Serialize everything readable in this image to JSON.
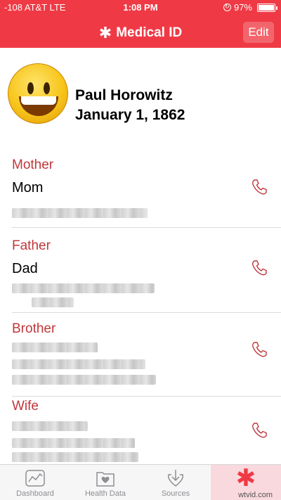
{
  "status": {
    "carrier": "-108 AT&T  LTE",
    "time": "1:08 PM",
    "battery": "97%",
    "battery_level": 0.97
  },
  "nav": {
    "star": "✱",
    "title": "Medical ID",
    "edit_label": "Edit"
  },
  "profile": {
    "name": "Paul Horowitz",
    "dob": "January 1, 1862"
  },
  "contacts": [
    {
      "relation": "Mother",
      "name": "Mom"
    },
    {
      "relation": "Father",
      "name": "Dad"
    },
    {
      "relation": "Brother",
      "name": ""
    },
    {
      "relation": "Wife",
      "name": ""
    }
  ],
  "tabs": [
    {
      "label": "Dashboard",
      "icon": "chart-icon"
    },
    {
      "label": "Health Data",
      "icon": "heart-folder-icon"
    },
    {
      "label": "Sources",
      "icon": "download-heart-icon"
    },
    {
      "label": "",
      "icon": "asterisk-icon"
    }
  ],
  "watermark": "wtvid.com",
  "colors": {
    "accent": "#ef3a45",
    "relation": "#c0373b"
  }
}
